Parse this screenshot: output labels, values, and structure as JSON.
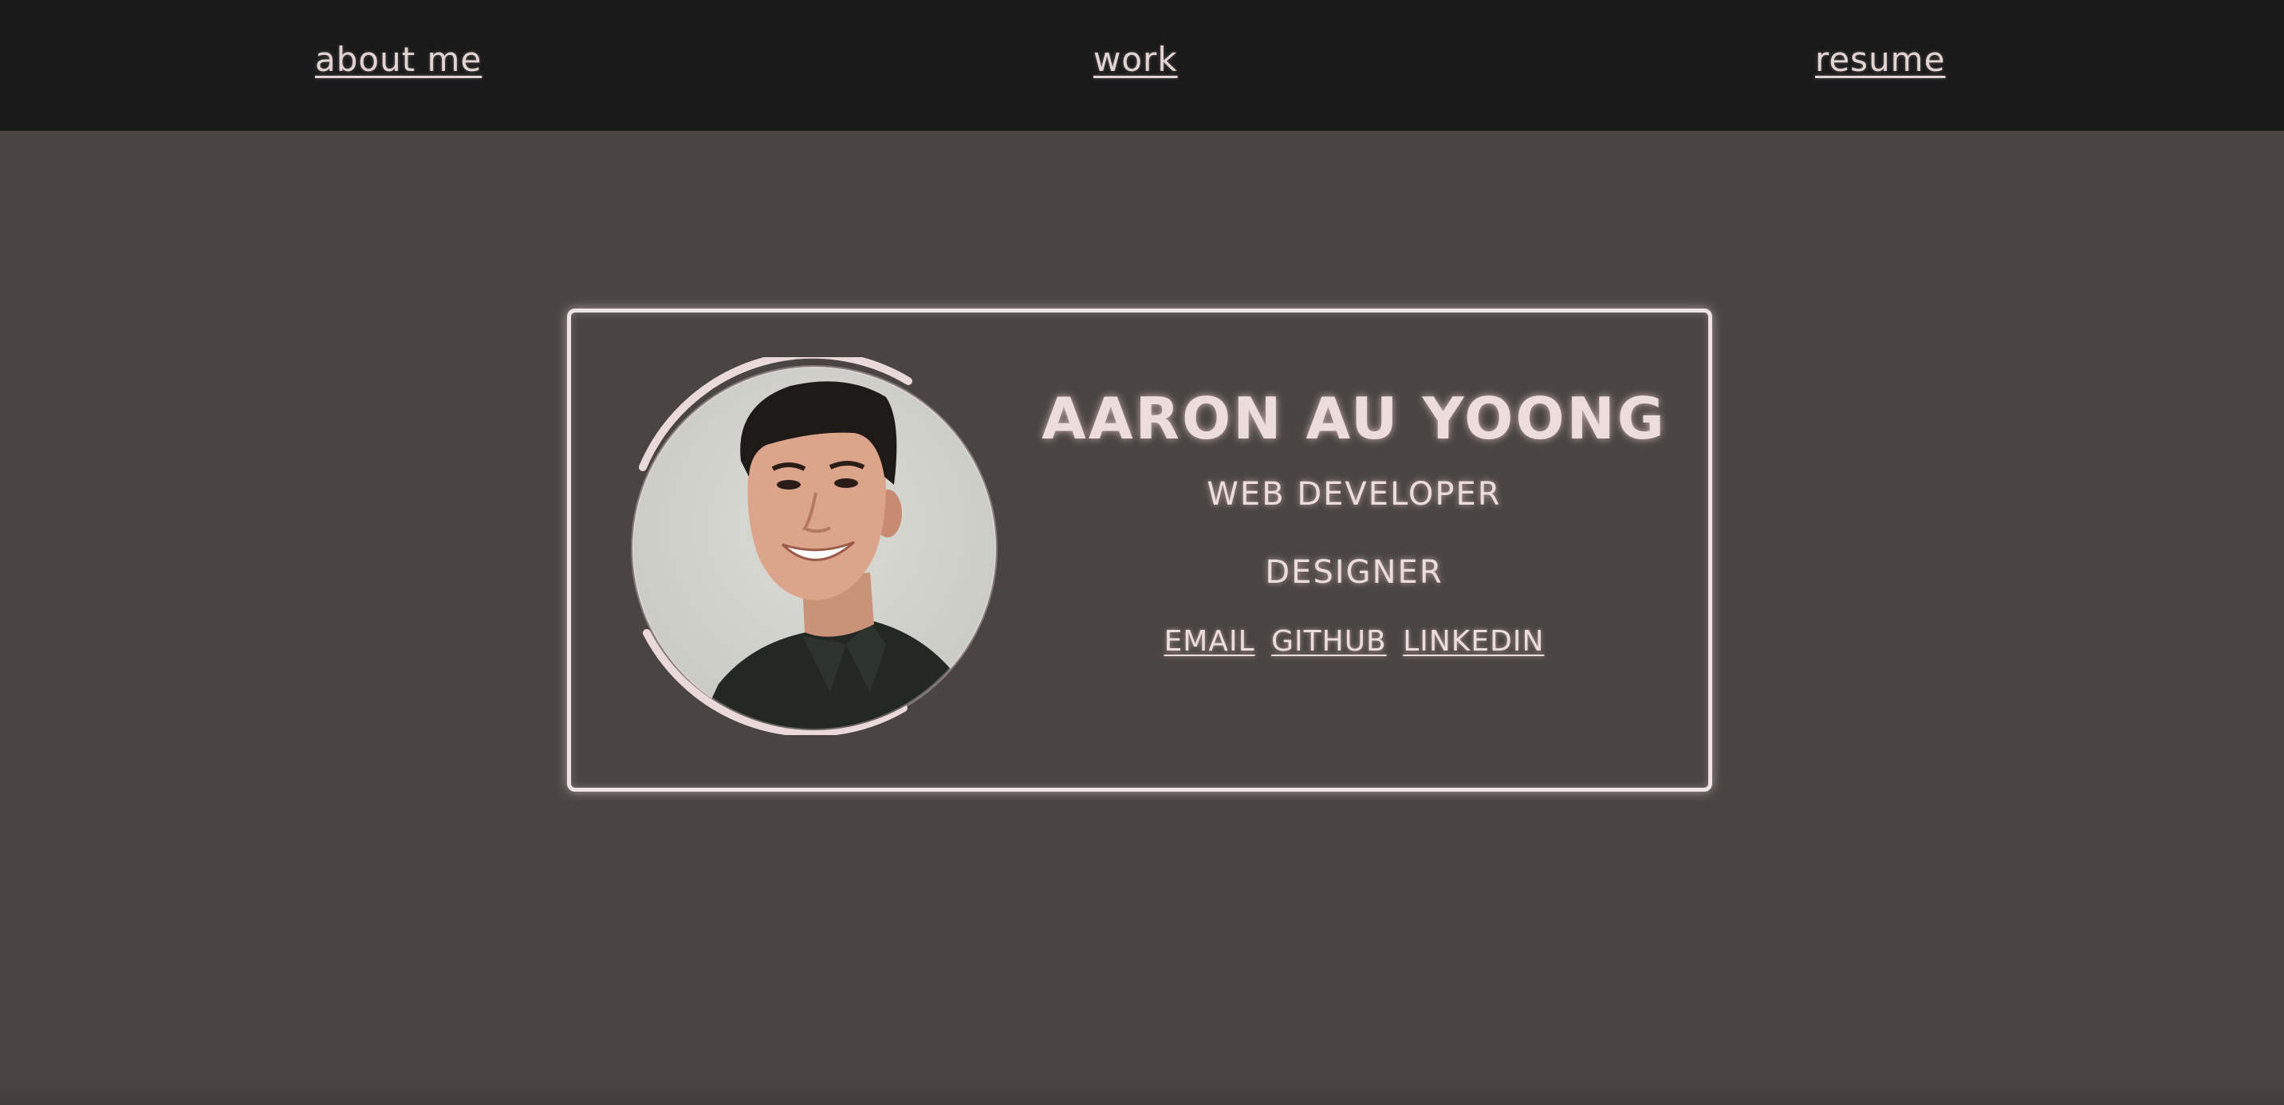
{
  "nav": {
    "about_label": "about me",
    "work_label": "work",
    "resume_label": "resume"
  },
  "profile": {
    "name": "AARON AU YOONG",
    "roles": [
      "WEB DEVELOPER",
      "DESIGNER"
    ],
    "links": [
      "EMAIL",
      "GITHUB",
      "LINKEDIN"
    ]
  },
  "colors": {
    "nav_bg": "#1a1a1a",
    "page_bg": "#4a4542",
    "accent_glow": "#efe3e3",
    "text": "#ecdcdc"
  }
}
